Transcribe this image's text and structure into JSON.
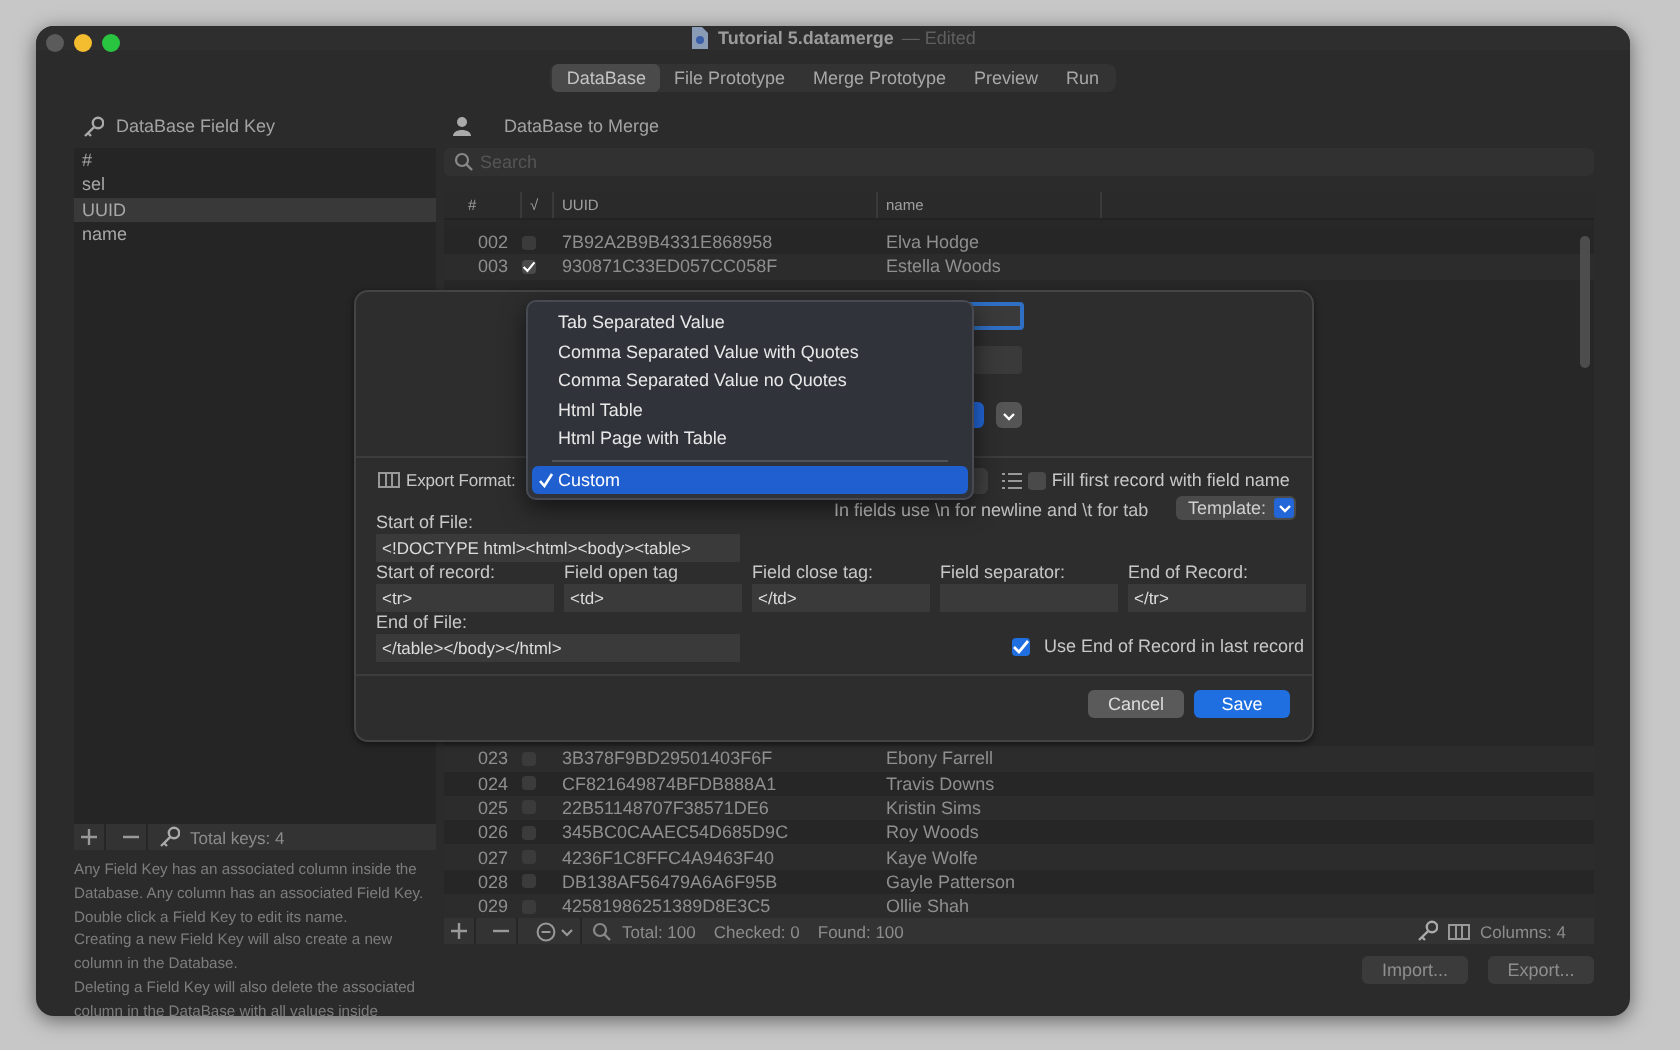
{
  "window": {
    "title": "Tutorial 5.datamerge",
    "title_status": "— Edited"
  },
  "tabs": [
    {
      "label": "DataBase",
      "selected": true
    },
    {
      "label": "File Prototype",
      "selected": false
    },
    {
      "label": "Merge Prototype",
      "selected": false
    },
    {
      "label": "Preview",
      "selected": false
    },
    {
      "label": "Run",
      "selected": false
    }
  ],
  "field_keys": {
    "title": "DataBase Field Key",
    "items": [
      {
        "label": "#",
        "selected": false
      },
      {
        "label": "sel",
        "selected": false
      },
      {
        "label": "UUID",
        "selected": true
      },
      {
        "label": "name",
        "selected": false
      }
    ],
    "total": "Total keys: 4",
    "help": [
      "Any Field Key has an associated column inside the Database. Any column has an associated Field Key.",
      "Double click a Field Key to edit its name.",
      "Creating a new Field Key will also create a new column in the Database.",
      "Deleting a Field Key will also delete the associated column in the DataBase with all values inside"
    ]
  },
  "database": {
    "title": "DataBase to Merge",
    "search": {
      "placeholder": "Search"
    },
    "columns": [
      "#",
      "√",
      "UUID",
      "name"
    ],
    "rows_top": [
      {
        "num": "002",
        "checked": false,
        "uuid": "7B92A2B9B4331E868958",
        "name": "Elva Hodge"
      },
      {
        "num": "003",
        "checked": true,
        "uuid": "930871C33ED057CC058F",
        "name": "Estella Woods"
      }
    ],
    "rows_bottom": [
      {
        "num": "023",
        "checked": false,
        "uuid": "3B378F9BD29501403F6F",
        "name": "Ebony Farrell"
      },
      {
        "num": "024",
        "checked": false,
        "uuid": "CF821649874BFDB888A1",
        "name": "Travis Downs"
      },
      {
        "num": "025",
        "checked": false,
        "uuid": "22B51148707F38571DE6",
        "name": "Kristin Sims"
      },
      {
        "num": "026",
        "checked": false,
        "uuid": "345BC0CAAEC54D685D9C",
        "name": "Roy Woods"
      },
      {
        "num": "027",
        "checked": false,
        "uuid": "4236F1C8FFC4A9463F40",
        "name": "Kaye Wolfe"
      },
      {
        "num": "028",
        "checked": false,
        "uuid": "DB138AF56479A6A6F95B",
        "name": "Gayle Patterson"
      },
      {
        "num": "029",
        "checked": false,
        "uuid": "42581986251389D8E3C5",
        "name": "Ollie Shah"
      }
    ],
    "status": {
      "total": "Total: 100",
      "checked": "Checked: 0",
      "found": "Found: 100",
      "columns": "Columns: 4"
    }
  },
  "buttons": [
    {
      "label": "Import..."
    },
    {
      "label": "Export..."
    }
  ],
  "export_sheet": {
    "export_format": {
      "label": "Export Format:"
    },
    "menu": {
      "items": [
        {
          "label": "Tab Separated Value",
          "selected": false
        },
        {
          "label": "Comma Separated Value with Quotes",
          "selected": false
        },
        {
          "label": "Comma Separated Value no Quotes",
          "selected": false
        },
        {
          "label": "Html Table",
          "selected": false
        },
        {
          "label": "Html Page with Table",
          "selected": false
        },
        {
          "label": "Custom",
          "selected": true
        }
      ]
    },
    "fill_first_record": {
      "label": "Fill first record with field name",
      "checked": false
    },
    "hint": "In fields use \\n for newline and \\t for tab",
    "template": {
      "label": "Template:"
    },
    "start_of_file": {
      "label": "Start of File:",
      "value": "<!DOCTYPE html><html><body><table>"
    },
    "record_fields": [
      {
        "label": "Start of record:",
        "value": "<tr>"
      },
      {
        "label": "Field open tag",
        "value": "<td>"
      },
      {
        "label": "Field close tag:",
        "value": "</td>"
      },
      {
        "label": "Field separator:"
      },
      {
        "label": "End of Record:",
        "value": "</tr>"
      }
    ],
    "end_of_file": {
      "label": "End of File:",
      "value": "</table></body></html>"
    },
    "use_end_of_record": {
      "label": "Use End of Record in last record",
      "checked": true
    },
    "buttons": [
      {
        "label": "Cancel",
        "kind": "cancel"
      },
      {
        "label": "Save",
        "kind": "default"
      }
    ]
  }
}
